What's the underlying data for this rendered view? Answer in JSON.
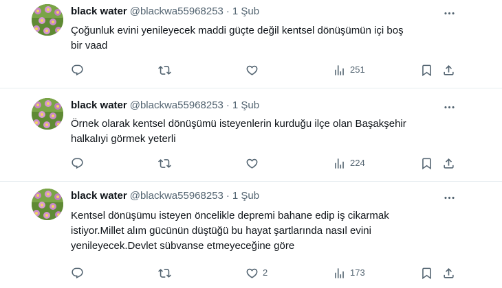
{
  "colors": {
    "text_primary": "#0f1419",
    "text_secondary": "#536471",
    "divider": "#e6ecf0",
    "background": "#ffffff"
  },
  "icons": {
    "reply": "reply-icon",
    "retweet": "retweet-icon",
    "like": "heart-icon",
    "views": "views-chart-icon",
    "bookmark": "bookmark-icon",
    "share": "share-icon",
    "more": "more-dots-icon"
  },
  "tweets": [
    {
      "author_name": "black water",
      "author_handle": "@blackwa55968253",
      "separator": "·",
      "date": "1 Şub",
      "text": "Çoğunluk evini yenileyecek maddi güçte değil kentsel dönüşümün içi boş\nbir vaad",
      "reply_count": "",
      "retweet_count": "",
      "like_count": "",
      "view_count": "251"
    },
    {
      "author_name": "black water",
      "author_handle": "@blackwa55968253",
      "separator": "·",
      "date": "1 Şub",
      "text": "Örnek olarak kentsel dönüşümü isteyenlerin kurduğu ilçe olan Başakşehir\nhalkalıyi görmek yeterli",
      "reply_count": "",
      "retweet_count": "",
      "like_count": "",
      "view_count": "224"
    },
    {
      "author_name": "black water",
      "author_handle": "@blackwa55968253",
      "separator": "·",
      "date": "1 Şub",
      "text": "Kentsel dönüşümu isteyen öncelikle depremi bahane edip iş cikarmak\nistiyor.Millet alım gücünün düştüğü bu hayat şartlarında nasıl evini\nyenileyecek.Devlet sübvanse etmeyeceğine göre",
      "reply_count": "",
      "retweet_count": "",
      "like_count": "2",
      "view_count": "173"
    }
  ]
}
